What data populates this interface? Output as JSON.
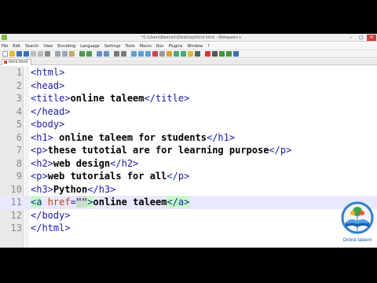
{
  "window": {
    "title": "*C:\\Users\\Beenish\\Desktop\\html.html - Notepad++",
    "min_label": "–",
    "max_label": "□",
    "close_label": "✕"
  },
  "menu": [
    "File",
    "Edit",
    "Search",
    "View",
    "Encoding",
    "Language",
    "Settings",
    "Tools",
    "Macro",
    "Run",
    "Plugins",
    "Window",
    "?"
  ],
  "toolbar_icons": [
    "new-file-icon",
    "open-file-icon",
    "save-icon",
    "save-all-icon",
    "close-icon",
    "close-all-icon",
    "print-icon",
    "cut-icon",
    "copy-icon",
    "paste-icon",
    "undo-icon",
    "redo-icon",
    "find-icon",
    "replace-icon",
    "zoom-in-icon",
    "zoom-out-icon",
    "sync-v-icon",
    "sync-h-icon",
    "wrap-icon",
    "all-chars-icon",
    "indent-guide-icon",
    "lang-icon",
    "doc-map-icon",
    "function-list-icon",
    "folder-icon",
    "monitor-icon",
    "record-icon",
    "stop-icon",
    "play-icon",
    "play-multi-icon",
    "save-macro-icon"
  ],
  "tab": {
    "label": "html.html"
  },
  "editor": {
    "lines": [
      {
        "num": "1",
        "code": "<html>"
      },
      {
        "num": "2",
        "code": "<head>"
      },
      {
        "num": "3",
        "code": "<title>online taleem</title>"
      },
      {
        "num": "4",
        "code": "</head>"
      },
      {
        "num": "5",
        "code": "<body>"
      },
      {
        "num": "6",
        "code": "<h1> online taleem for students</h1>"
      },
      {
        "num": "7",
        "code": "<p>these tutotial are for learning purpose</p>"
      },
      {
        "num": "8",
        "code": "<h2>web design</h2>"
      },
      {
        "num": "9",
        "code": "<p>web tutorials for all</p>"
      },
      {
        "num": "10",
        "code": "<h3>Python</h3>"
      },
      {
        "num": "11",
        "code": "<a href=\"\">online taleem</a>"
      },
      {
        "num": "12",
        "code": "</body>"
      },
      {
        "num": "13",
        "code": "</html>"
      }
    ],
    "active_line": 11
  },
  "logo": {
    "text": "Online taleem"
  },
  "colors": {
    "tag": "#1a1aa6",
    "attr": "#c2410c",
    "active_line": "#e8e8ff"
  }
}
